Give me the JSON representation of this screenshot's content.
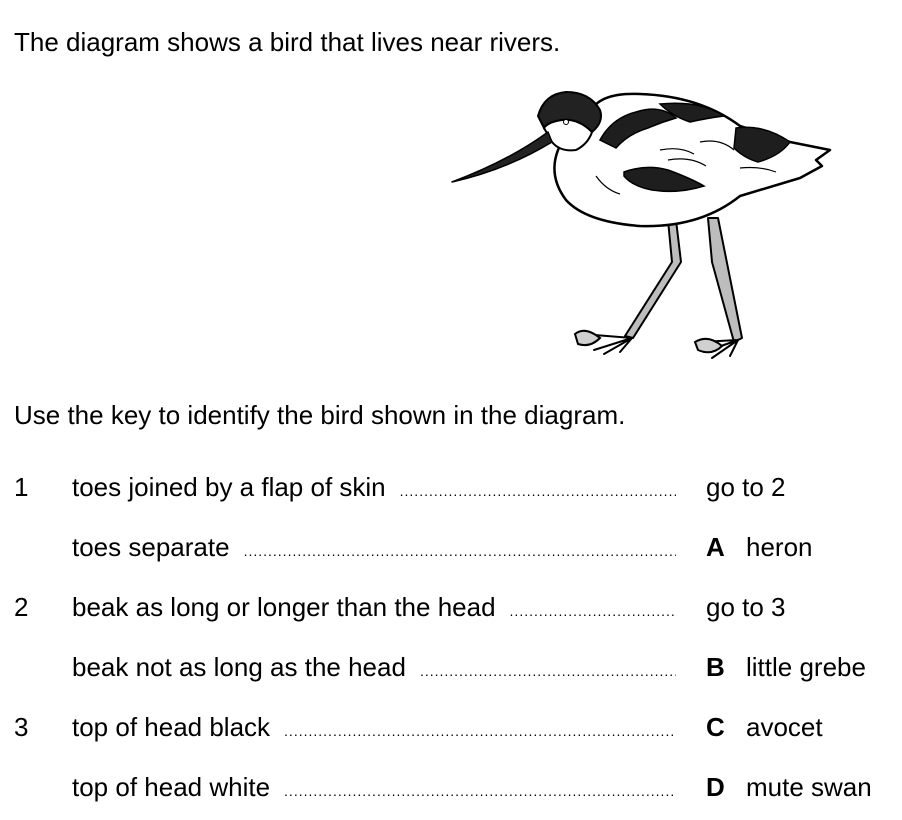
{
  "intro": "The diagram shows a bird that lives near rivers.",
  "instruction": "Use the key to identify the bird shown in the diagram.",
  "dots": "..........................................................................................................................................................",
  "key": [
    {
      "num": "1",
      "description": "toes joined by a flap of skin",
      "letter": "",
      "result": "go to 2"
    },
    {
      "num": "",
      "description": "toes separate",
      "letter": "A",
      "result": "heron"
    },
    {
      "num": "2",
      "description": "beak as long or longer than the head",
      "letter": "",
      "result": "go to 3"
    },
    {
      "num": "",
      "description": "beak not as long as the head",
      "letter": "B",
      "result": "little grebe"
    },
    {
      "num": "3",
      "description": "top of head black",
      "letter": "C",
      "result": "avocet"
    },
    {
      "num": "",
      "description": "top of head white",
      "letter": "D",
      "result": "mute swan"
    }
  ]
}
